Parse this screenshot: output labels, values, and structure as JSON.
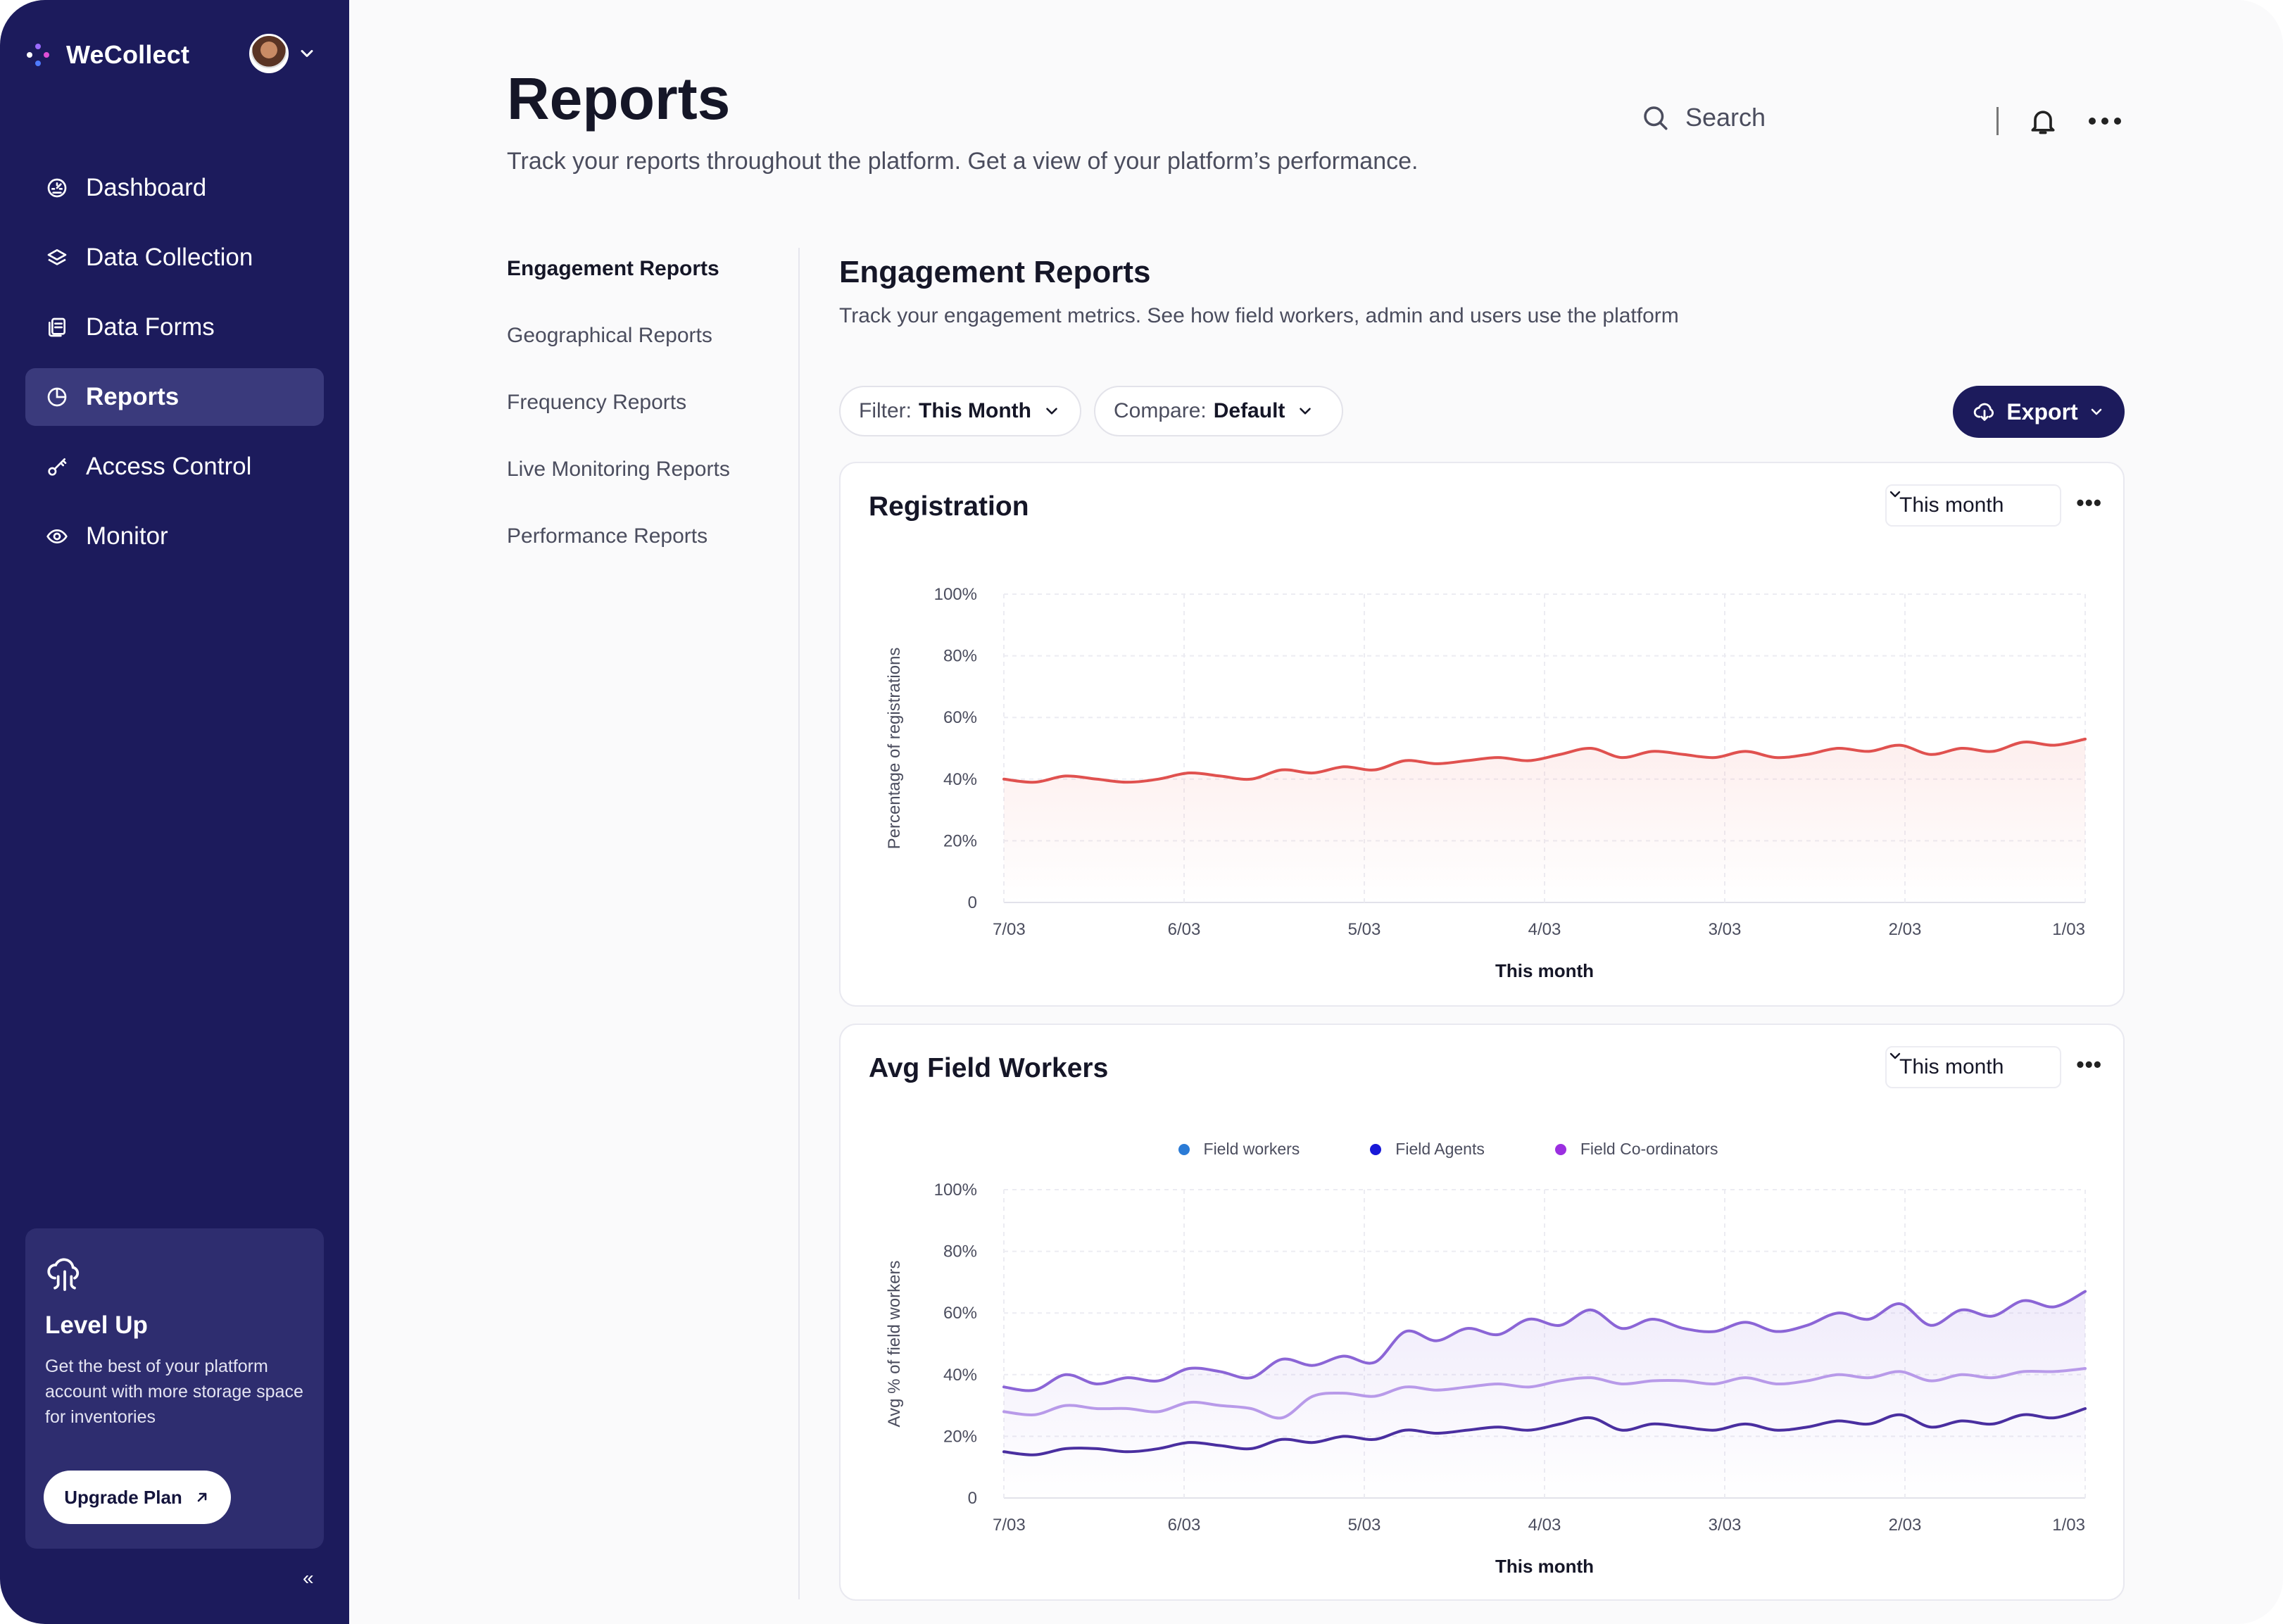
{
  "app": {
    "name": "WeCollect"
  },
  "sidebar": {
    "items": [
      {
        "label": "Dashboard",
        "icon": "dashboard-icon"
      },
      {
        "label": "Data Collection",
        "icon": "layers-icon"
      },
      {
        "label": "Data Forms",
        "icon": "forms-icon"
      },
      {
        "label": "Reports",
        "icon": "pie-chart-icon",
        "active": true
      },
      {
        "label": "Access Control",
        "icon": "key-icon"
      },
      {
        "label": "Monitor",
        "icon": "eye-icon"
      }
    ],
    "level_up": {
      "title": "Level Up",
      "text": "Get the best of your platform account with more storage space for inventories",
      "button": "Upgrade Plan"
    },
    "collapse_label": "«"
  },
  "header": {
    "title": "Reports",
    "subtitle": "Track your reports throughout the platform. Get a view of your platform’s performance.",
    "search_placeholder": "Search"
  },
  "subnav": {
    "items": [
      "Engagement Reports",
      "Geographical Reports",
      "Frequency Reports",
      "Live Monitoring Reports",
      "Performance Reports"
    ],
    "active_index": 0
  },
  "section": {
    "title": "Engagement Reports",
    "subtitle": "Track your engagement metrics. See how field workers, admin and users use the platform",
    "filter": {
      "label": "Filter:",
      "value": "This Month"
    },
    "compare": {
      "label": "Compare:",
      "value": "Default"
    },
    "export_label": "Export"
  },
  "colors": {
    "sidebar": "#1c1b5c",
    "registration_line": "#e0514f",
    "field_workers": "#2b7bd6",
    "field_agents": "#1818d8",
    "field_coordinators": "#9b2fe0"
  },
  "chart_data": [
    {
      "type": "line",
      "title": "Registration",
      "period": "This month",
      "xlabel": "This month",
      "ylabel": "Percentage of registrations",
      "x": [
        "7/03",
        "6/03",
        "5/03",
        "4/03",
        "3/03",
        "2/03",
        "1/03"
      ],
      "ytick_labels": [
        "0",
        "20%",
        "40%",
        "60%",
        "80%",
        "100%"
      ],
      "ylim": [
        0,
        100
      ],
      "grid": true,
      "series": [
        {
          "values": [
            40,
            39,
            41,
            40,
            39,
            40,
            42,
            41,
            40,
            43,
            42,
            44,
            43,
            46,
            45,
            46,
            47,
            46,
            48,
            50,
            47,
            49,
            48,
            47,
            49,
            47,
            48,
            50,
            49,
            51,
            48,
            50,
            49,
            52,
            51,
            53
          ]
        }
      ]
    },
    {
      "type": "line",
      "title": "Avg Field Workers",
      "period": "This month",
      "xlabel": "This month",
      "ylabel": "Avg % of field workers",
      "x": [
        "7/03",
        "6/03",
        "5/03",
        "4/03",
        "3/03",
        "2/03",
        "1/03"
      ],
      "ytick_labels": [
        "0",
        "20%",
        "40%",
        "60%",
        "80%",
        "100%"
      ],
      "ylim": [
        0,
        100
      ],
      "grid": true,
      "legend_position": "top-center",
      "series": [
        {
          "name": "Field workers",
          "values": [
            36,
            35,
            40,
            37,
            39,
            38,
            42,
            41,
            39,
            45,
            43,
            46,
            44,
            54,
            51,
            55,
            53,
            58,
            56,
            61,
            55,
            58,
            55,
            54,
            57,
            54,
            56,
            60,
            58,
            63,
            56,
            61,
            59,
            64,
            62,
            67
          ]
        },
        {
          "name": "Field Agents",
          "values": [
            15,
            14,
            16,
            16,
            15,
            16,
            18,
            17,
            16,
            19,
            18,
            20,
            19,
            22,
            21,
            22,
            23,
            22,
            24,
            26,
            22,
            24,
            23,
            22,
            24,
            22,
            23,
            25,
            24,
            27,
            23,
            25,
            24,
            27,
            26,
            29
          ]
        },
        {
          "name": "Field Co-ordinators",
          "values": [
            28,
            27,
            30,
            29,
            29,
            28,
            31,
            30,
            29,
            26,
            33,
            34,
            33,
            36,
            35,
            36,
            37,
            36,
            38,
            39,
            37,
            38,
            38,
            37,
            39,
            37,
            38,
            40,
            39,
            41,
            38,
            40,
            39,
            41,
            41,
            42
          ]
        }
      ]
    }
  ]
}
